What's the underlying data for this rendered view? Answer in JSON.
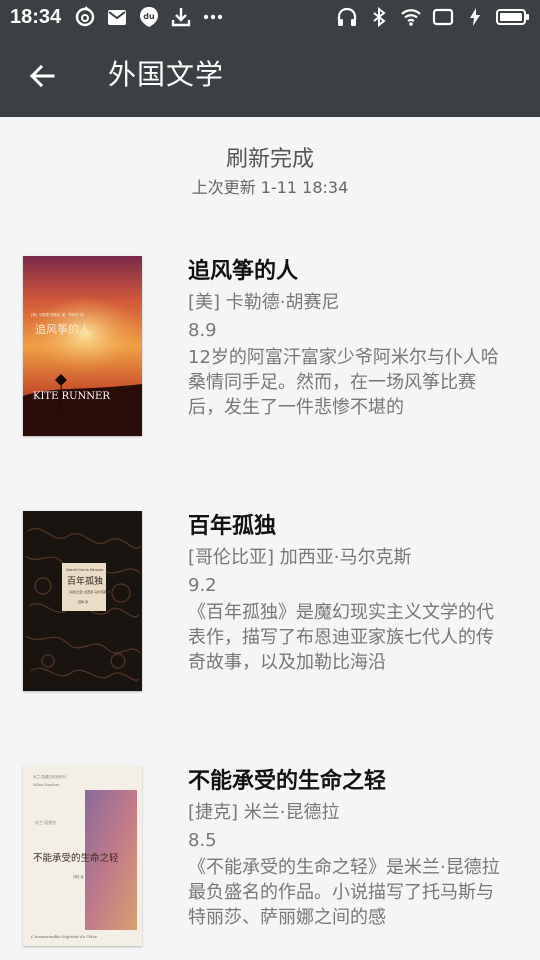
{
  "status_bar": {
    "time": "18:34",
    "left_icons": [
      "netease-music-icon",
      "mail-icon",
      "du-icon",
      "download-icon",
      "more-dots-icon"
    ],
    "right_icons": [
      "headset-icon",
      "bluetooth-icon",
      "wifi-icon",
      "screen-icon",
      "charging-icon",
      "battery-icon"
    ]
  },
  "toolbar": {
    "back_icon": "arrow-left-icon",
    "title": "外国文学"
  },
  "refresh": {
    "title": "刷新完成",
    "last_updated": "上次更新 1-11 18:34"
  },
  "books": [
    {
      "title": "追风筝的人",
      "author": "[美] 卡勒德·胡赛尼",
      "rating": "8.9",
      "summary": "12岁的阿富汗富家少爷阿米尔与仆人哈桑情同手足。然而，在一场风筝比赛后，发生了一件悲惨不堪的",
      "cover_title": "追风筝的人",
      "cover_subtitle": "KITE RUNNER"
    },
    {
      "title": "百年孤独",
      "author": "[哥伦比亚] 加西亚·马尔克斯",
      "rating": "9.2",
      "summary": "《百年孤独》是魔幻现实主义文学的代表作，描写了布恩迪亚家族七代人的传奇故事，以及加勒比海沿",
      "cover_title": "百年孤独"
    },
    {
      "title": "不能承受的生命之轻",
      "author": "[捷克] 米兰·昆德拉",
      "rating": "8.5",
      "summary": "《不能承受的生命之轻》是米兰·昆德拉最负盛名的作品。小说描写了托马斯与特丽莎、萨丽娜之间的感",
      "cover_title": "不能承受的生命之轻",
      "cover_subtitle": "L'insoutenable légèreté de l'être"
    }
  ]
}
